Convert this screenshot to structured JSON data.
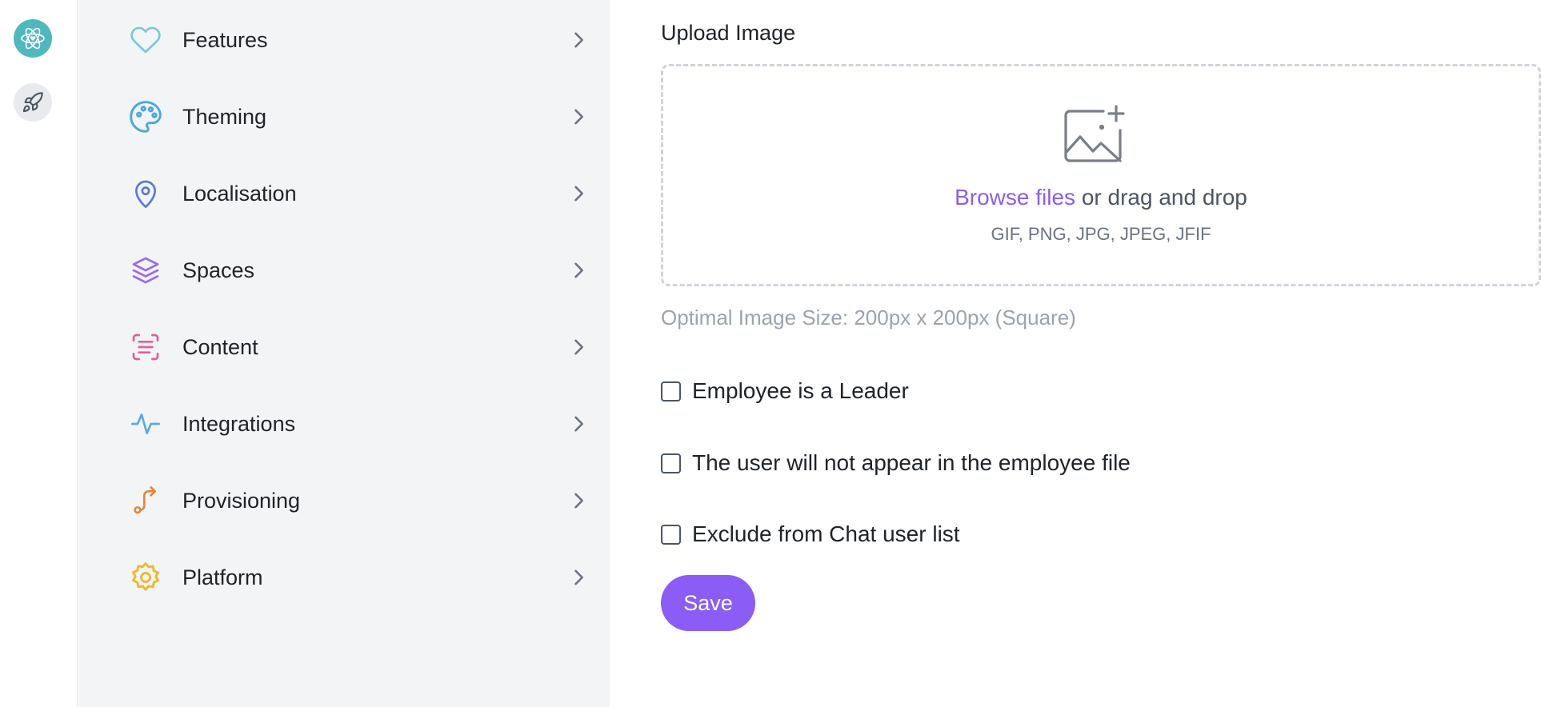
{
  "rail": {
    "items": [
      {
        "icon": "atom-heart-icon",
        "color": "#4fb8bd"
      },
      {
        "icon": "rocket-icon",
        "color": "#e9eaed"
      }
    ]
  },
  "menu": {
    "items": [
      {
        "label": "Features",
        "icon": "heart-icon",
        "color": "#7cc7dc"
      },
      {
        "label": "Theming",
        "icon": "palette-icon",
        "color": "#4aa8e0"
      },
      {
        "label": "Localisation",
        "icon": "map-pin-icon",
        "color": "#5a78d6"
      },
      {
        "label": "Spaces",
        "icon": "layers-icon",
        "color": "#9b6cf0"
      },
      {
        "label": "Content",
        "icon": "scan-text-icon",
        "color": "#e0609b"
      },
      {
        "label": "Integrations",
        "icon": "activity-icon",
        "color": "#5aa8e6"
      },
      {
        "label": "Provisioning",
        "icon": "route-icon",
        "color": "#e0893a"
      },
      {
        "label": "Platform",
        "icon": "gear-icon",
        "color": "#f0b928"
      }
    ]
  },
  "upload": {
    "title": "Upload Image",
    "browse_label": "Browse files",
    "drag_text": "or drag and drop",
    "file_types": "GIF, PNG, JPG, JPEG, JFIF",
    "hint": "Optimal Image Size: 200px x 200px (Square)"
  },
  "options": [
    {
      "label": "Employee is a Leader",
      "checked": false
    },
    {
      "label": "The user will not appear in the employee file",
      "checked": false
    },
    {
      "label": "Exclude from Chat user list",
      "checked": false
    }
  ],
  "save_label": "Save",
  "colors": {
    "accent": "#8b5cf6",
    "sidebar_bg": "#f3f4f6"
  }
}
